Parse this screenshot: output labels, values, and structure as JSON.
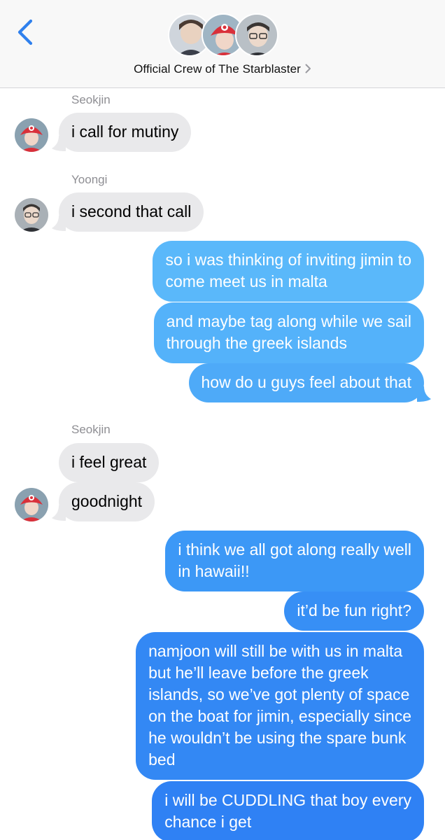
{
  "header": {
    "title": "Official Crew of The Starblaster",
    "back_icon": "chevron-left-icon",
    "disclosure_icon": "chevron-right-icon",
    "avatars": [
      "avatar-member-1",
      "avatar-seokjin",
      "avatar-yoongi"
    ]
  },
  "colors": {
    "sent_top": "#5ac0fb",
    "sent_bottom": "#2b7ef4",
    "received": "#e9e9eb",
    "back": "#2f80ed"
  },
  "thread": {
    "names": {
      "seokjin_1": "Seokjin",
      "yoongi": "Yoongi",
      "seokjin_2": "Seokjin"
    },
    "messages": {
      "m1": "i call for mutiny",
      "m2": "i second that call",
      "m3": "so i was thinking of inviting jimin to\ncome meet us in malta",
      "m4": "and maybe tag along while we sail\nthrough the greek islands",
      "m5": "how do u guys feel about that",
      "m6": "i feel great",
      "m7": "goodnight",
      "m8": "i think we all got along really well\nin hawaii!!",
      "m9": "it’d be fun right?",
      "m10": "namjoon will still be with us in malta\nbut he’ll leave before the greek\nislands, so we’ve got plenty of space\non the boat for jimin, especially since\nhe wouldn’t be using the spare bunk\nbed",
      "m11": "i will be CUDDLING that boy every\nchance i get"
    }
  }
}
